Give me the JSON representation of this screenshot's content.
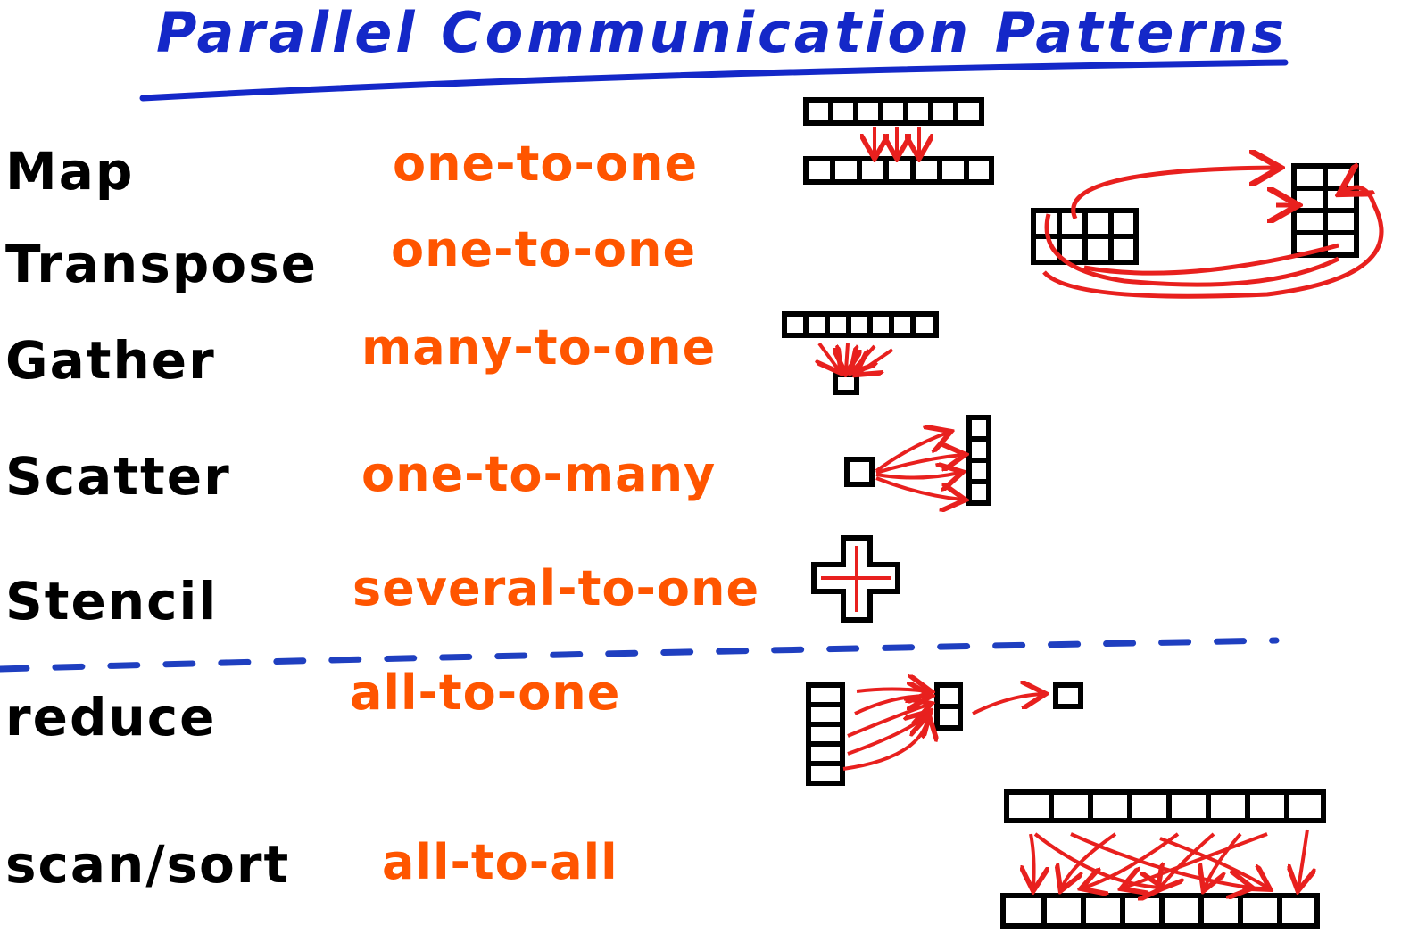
{
  "title": "Parallel Communication Patterns",
  "colors": {
    "title": "#1428c8",
    "name": "#000000",
    "desc": "#ff5500",
    "arrow": "#e8201e",
    "divider": "#1f3fc0"
  },
  "patterns": [
    {
      "name": "Map",
      "desc": "one-to-one"
    },
    {
      "name": "Transpose",
      "desc": "one-to-one"
    },
    {
      "name": "Gather",
      "desc": "many-to-one"
    },
    {
      "name": "Scatter",
      "desc": "one-to-many"
    },
    {
      "name": "Stencil",
      "desc": "several-to-one"
    },
    {
      "name": "reduce",
      "desc": "all-to-one"
    },
    {
      "name": "scan/sort",
      "desc": "all-to-all"
    }
  ]
}
